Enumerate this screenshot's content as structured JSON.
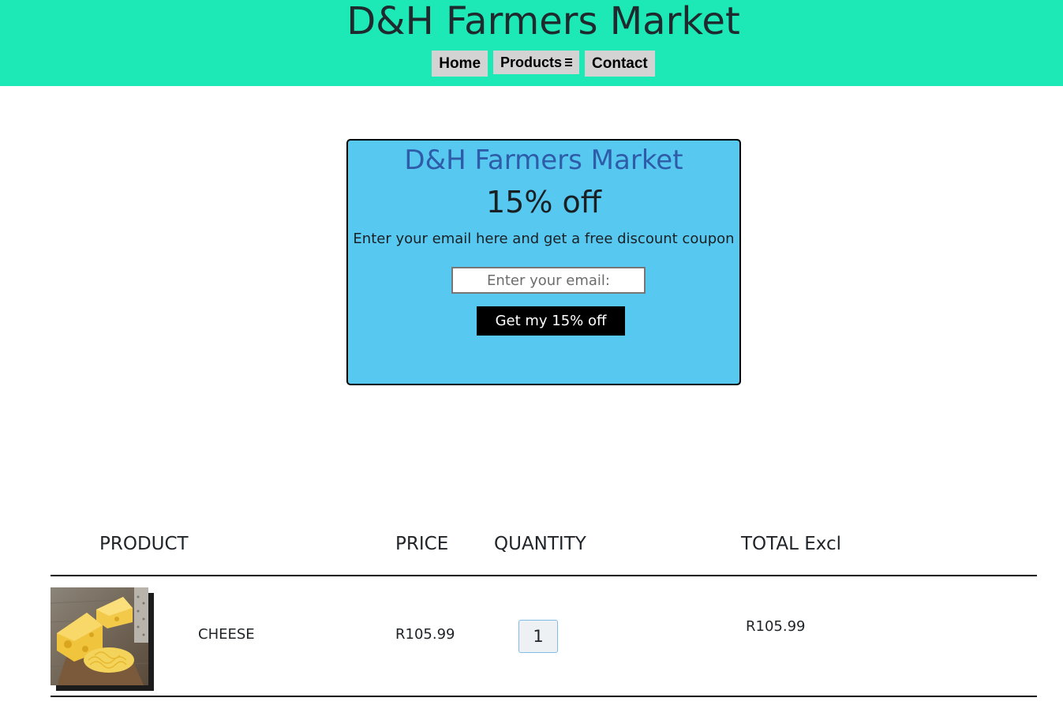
{
  "header": {
    "title": "D&H Farmers Market",
    "nav": {
      "home_label": "Home",
      "products_label": "Products",
      "contact_label": "Contact"
    }
  },
  "promo": {
    "title": "D&H Farmers Market",
    "discount": "15% off",
    "text": "Enter your email here and get a free discount coupon",
    "email_placeholder": "Enter your email:",
    "button_label": "Get my 15% off"
  },
  "cart": {
    "columns": {
      "product": "PRODUCT",
      "price": "PRICE",
      "quantity": "QUANTITY",
      "total": "TOTAL Excl"
    },
    "rows": [
      {
        "name": "CHEESE",
        "price": "R105.99",
        "quantity": "1",
        "total": "R105.99"
      }
    ]
  },
  "colors": {
    "header_bg": "#1de9b6",
    "promo_bg": "#57c9f1",
    "promo_title": "#2e5ca8",
    "cta_bg": "#000000"
  }
}
